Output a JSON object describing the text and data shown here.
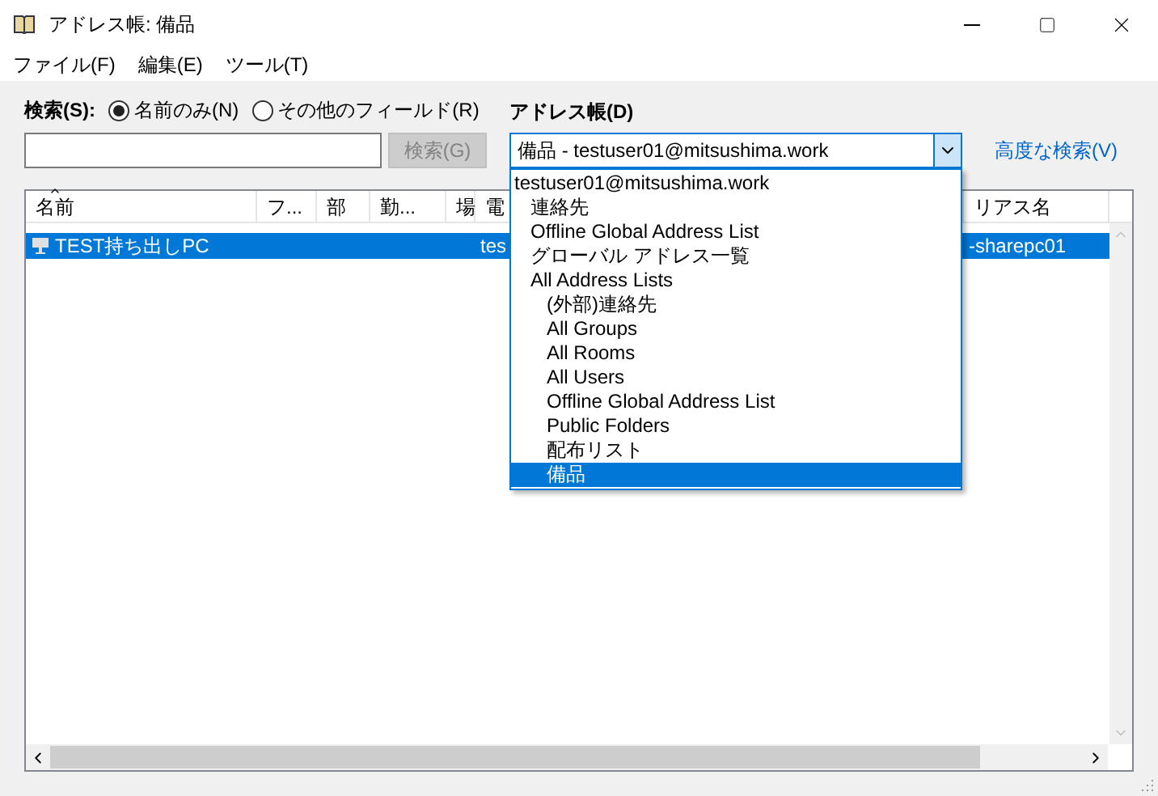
{
  "window": {
    "title": "アドレス帳: 備品"
  },
  "menu": [
    "ファイル(F)",
    "編集(E)",
    "ツール(T)"
  ],
  "search": {
    "label": "検索(S):",
    "options": [
      {
        "label": "名前のみ(N)",
        "selected": true
      },
      {
        "label": "その他のフィールド(R)",
        "selected": false
      }
    ],
    "button": {
      "label": "検索(G)",
      "disabled": true
    }
  },
  "address_book": {
    "label": "アドレス帳(D)",
    "value": "備品 - testuser01@mitsushima.work",
    "expanded": true,
    "options": [
      {
        "label": "testuser01@mitsushima.work",
        "selected": false,
        "children": [
          {
            "label": "連絡先",
            "selected": false
          },
          {
            "label": "Offline Global Address List",
            "selected": false
          },
          {
            "label": "グローバル アドレス一覧",
            "selected": false
          },
          {
            "label": "All Address Lists",
            "selected": false,
            "children": [
              {
                "label": "(外部)連絡先",
                "selected": false
              },
              {
                "label": "All Groups",
                "selected": false
              },
              {
                "label": "All Rooms",
                "selected": false
              },
              {
                "label": "All Users",
                "selected": false
              },
              {
                "label": "Offline Global Address List",
                "selected": false
              },
              {
                "label": "Public Folders",
                "selected": false
              },
              {
                "label": "配布リスト",
                "selected": false
              },
              {
                "label": "備品",
                "selected": true
              }
            ]
          }
        ]
      }
    ]
  },
  "advanced_search": "高度な検索(V)",
  "table": {
    "columns": [
      {
        "label": "名前",
        "sorted": true
      },
      {
        "label": "フ...",
        "sorted": false
      },
      {
        "label": "部",
        "sorted": false
      },
      {
        "label": "勤...",
        "sorted": false
      },
      {
        "label": "場",
        "sorted": false
      },
      {
        "label": "電",
        "sorted": false
      },
      {
        "label": "リアス名",
        "sorted": false
      }
    ],
    "rows": [
      {
        "selected": true,
        "cells": [
          "TEST持ち出しPC",
          null,
          null,
          null,
          null,
          "tes",
          "-sharepc01"
        ]
      }
    ]
  }
}
